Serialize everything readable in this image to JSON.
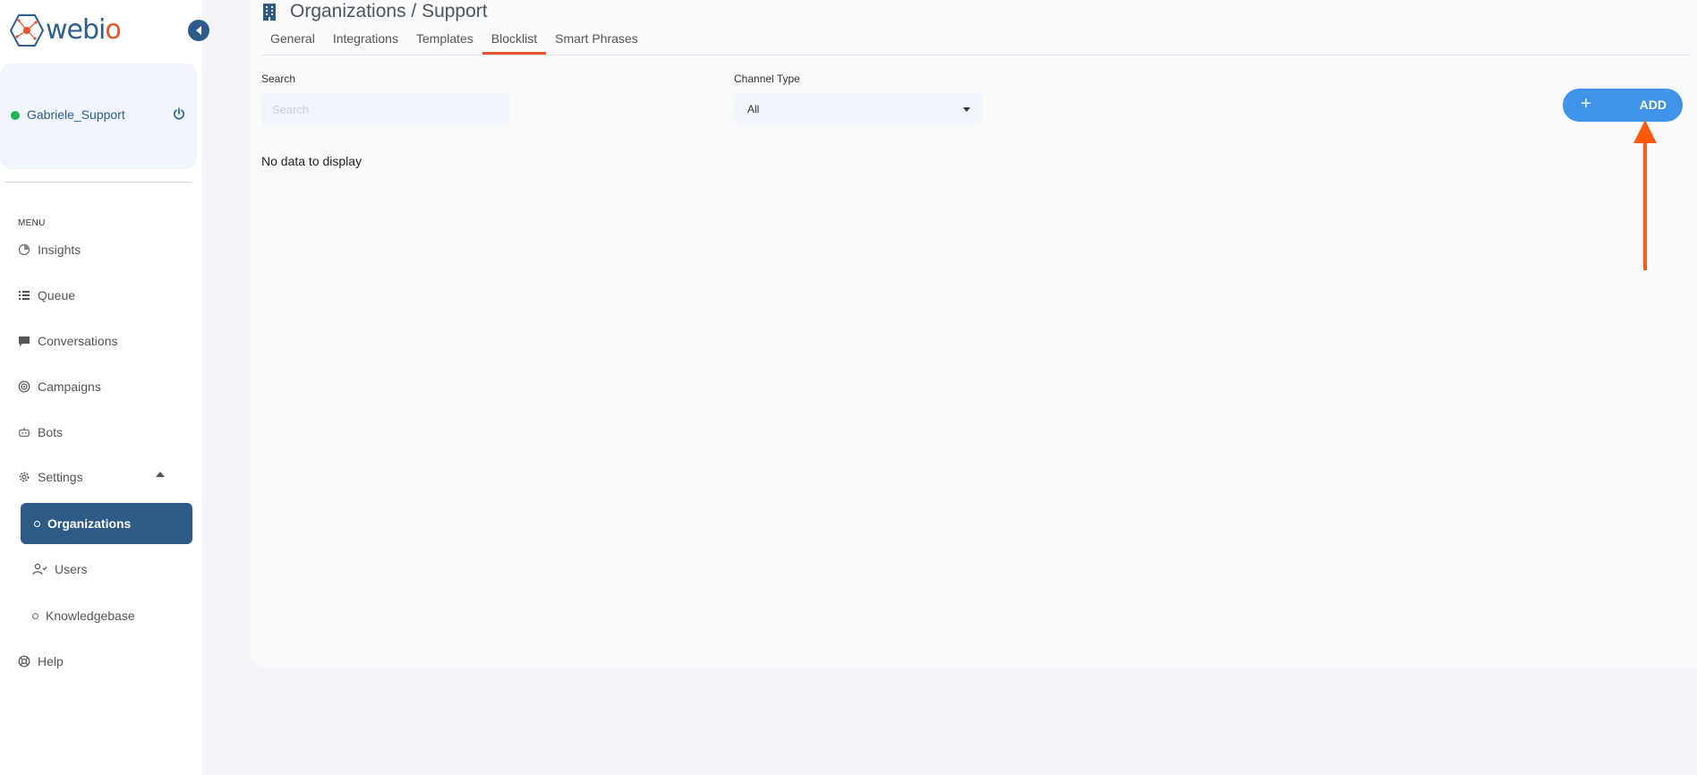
{
  "brand": {
    "name_prefix": "webi",
    "name_suffix": "o"
  },
  "user": {
    "name": "Gabriele_Support",
    "status_color": "#21b35a"
  },
  "menu": {
    "heading": "MENU",
    "items": [
      {
        "label": "Insights",
        "icon": "insights-icon"
      },
      {
        "label": "Queue",
        "icon": "queue-icon"
      },
      {
        "label": "Conversations",
        "icon": "chat-icon"
      },
      {
        "label": "Campaigns",
        "icon": "target-icon"
      },
      {
        "label": "Bots",
        "icon": "robot-icon"
      },
      {
        "label": "Settings",
        "icon": "gear-icon"
      }
    ],
    "settings_sub": [
      {
        "label": "Organizations",
        "active": true
      },
      {
        "label": "Users",
        "icon": "users-icon"
      },
      {
        "label": "Knowledgebase"
      }
    ],
    "help": {
      "label": "Help",
      "icon": "lifebuoy-icon"
    }
  },
  "page": {
    "title": "Organizations / Support",
    "tabs": [
      {
        "label": "General"
      },
      {
        "label": "Integrations"
      },
      {
        "label": "Templates"
      },
      {
        "label": "Blocklist",
        "active": true
      },
      {
        "label": "Smart Phrases"
      }
    ]
  },
  "filters": {
    "search_label": "Search",
    "search_placeholder": "Search",
    "search_value": "",
    "channel_label": "Channel Type",
    "channel_value": "All"
  },
  "actions": {
    "add_label": "ADD",
    "add_icon": "+"
  },
  "table": {
    "empty_text": "No data to display"
  },
  "colors": {
    "primary": "#2e5b86",
    "accent": "#e8532d",
    "button": "#3f93e8",
    "annotation": "#ff5a0a"
  }
}
